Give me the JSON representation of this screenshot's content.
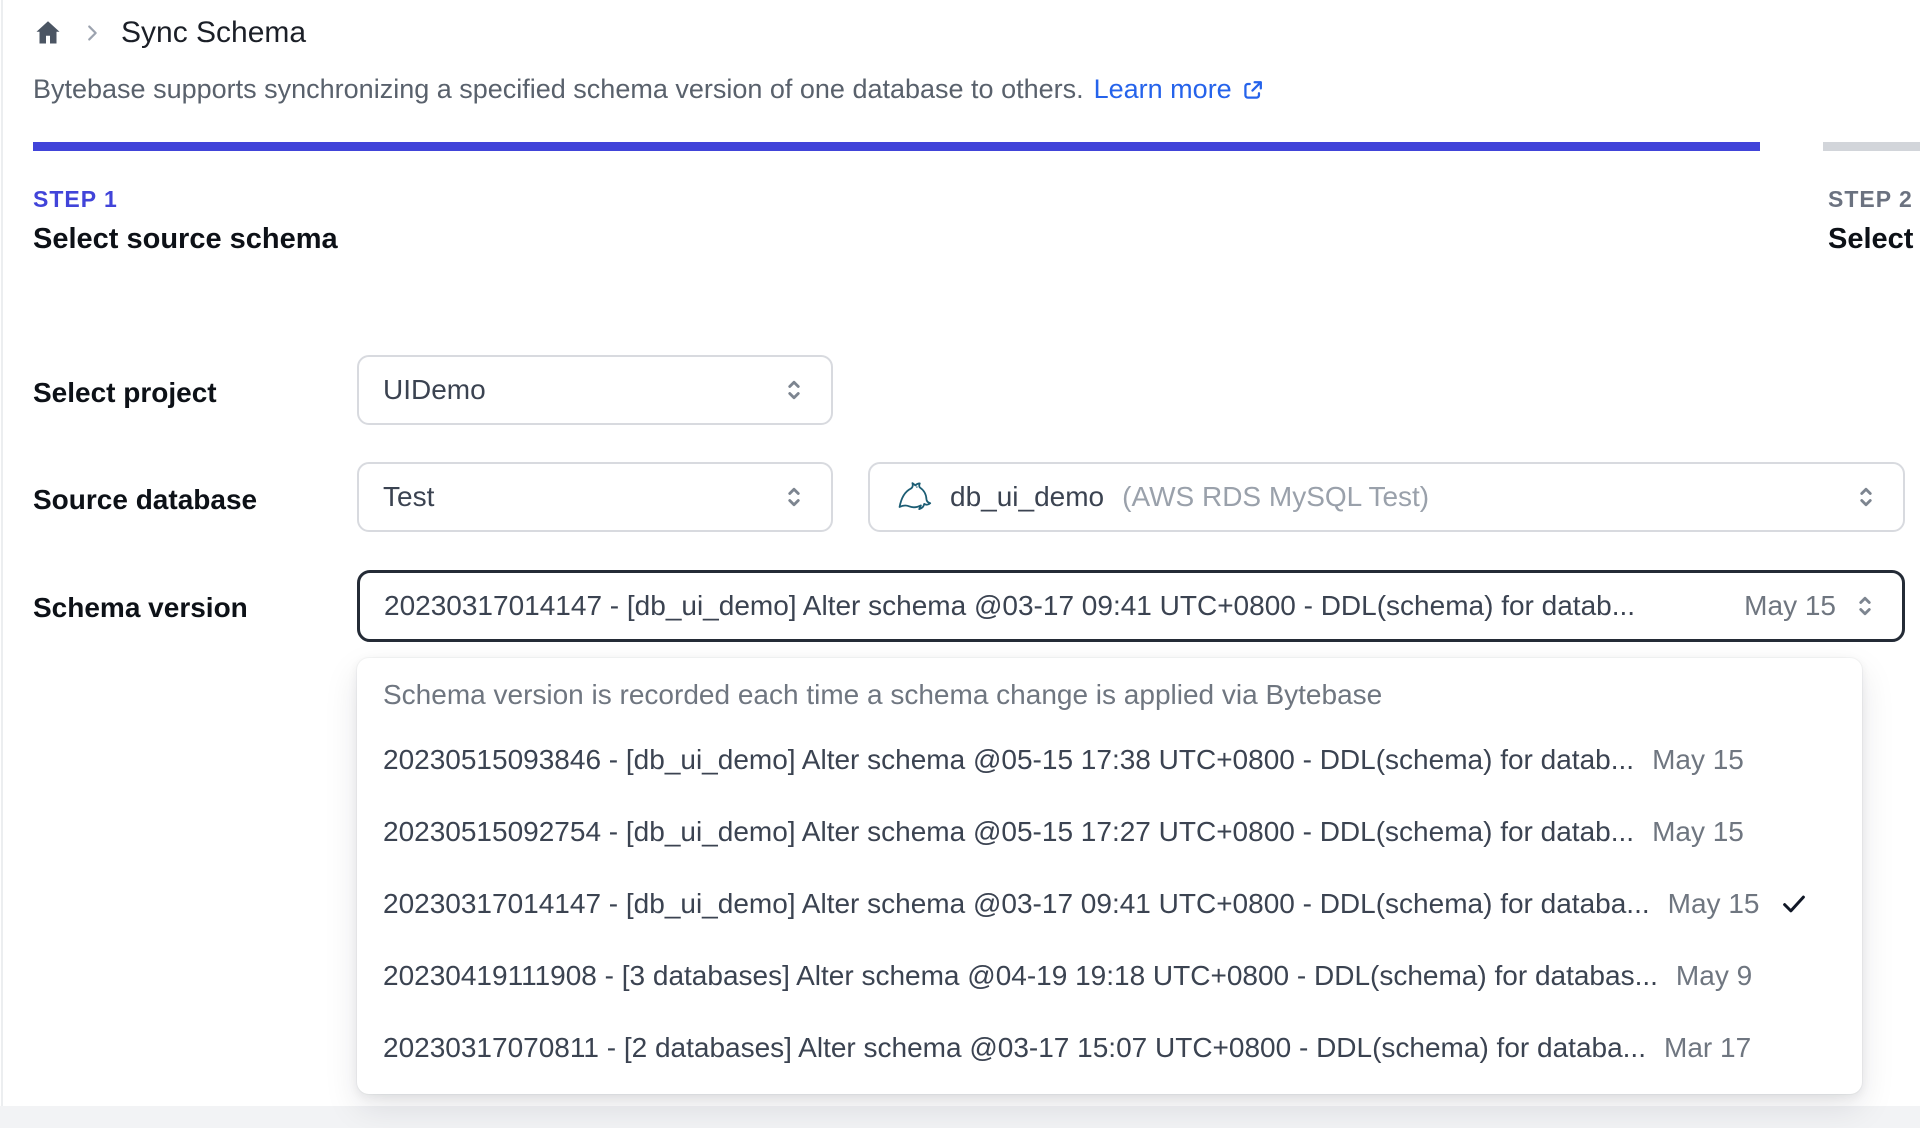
{
  "breadcrumb": {
    "title": "Sync Schema"
  },
  "description": {
    "text": "Bytebase supports synchronizing a specified schema version of one database to others.",
    "link_label": "Learn more"
  },
  "steps": [
    {
      "label": "STEP 1",
      "title": "Select source schema",
      "active": true
    },
    {
      "label": "STEP 2",
      "title": "Select t",
      "active": false
    }
  ],
  "form": {
    "project": {
      "label": "Select project",
      "value": "UIDemo"
    },
    "source_database": {
      "label": "Source database",
      "environment_value": "Test",
      "database_value": "db_ui_demo",
      "database_hint": "(AWS RDS MySQL Test)"
    },
    "schema_version": {
      "label": "Schema version",
      "value": "20230317014147 - [db_ui_demo] Alter schema @03-17 09:41 UTC+0800 - DDL(schema) for datab...",
      "date": "May 15"
    }
  },
  "dropdown": {
    "header": "Schema version is recorded each time a schema change is applied via Bytebase",
    "options": [
      {
        "text": "20230515093846 - [db_ui_demo] Alter schema @05-15 17:38 UTC+0800 - DDL(schema) for datab...",
        "date": "May 15",
        "selected": false
      },
      {
        "text": "20230515092754 - [db_ui_demo] Alter schema @05-15 17:27 UTC+0800 - DDL(schema) for datab...",
        "date": "May 15",
        "selected": false
      },
      {
        "text": "20230317014147 - [db_ui_demo] Alter schema @03-17 09:41 UTC+0800 - DDL(schema) for databa...",
        "date": "May 15",
        "selected": true
      },
      {
        "text": "20230419111908 - [3 databases] Alter schema @04-19 19:18 UTC+0800 - DDL(schema) for databas...",
        "date": "May 9",
        "selected": false
      },
      {
        "text": "20230317070811 - [2 databases] Alter schema @03-17 15:07 UTC+0800 - DDL(schema) for databa...",
        "date": "Mar 17",
        "selected": false
      }
    ]
  },
  "icons": {
    "breadcrumb_home": "home-icon",
    "breadcrumb_separator": "chevron-right-icon",
    "learn_more": "external-link-icon",
    "select_control": "chevron-up-down-icon",
    "database_engine": "mysql-dolphin-icon",
    "selected_option": "check-icon"
  },
  "colors": {
    "accent-indigo": "#4144d9",
    "link-blue": "#2563eb",
    "bar-gray": "#d2d5da",
    "border": "#d8dadf",
    "focus-border": "#242b36",
    "text-dark": "#111827"
  }
}
